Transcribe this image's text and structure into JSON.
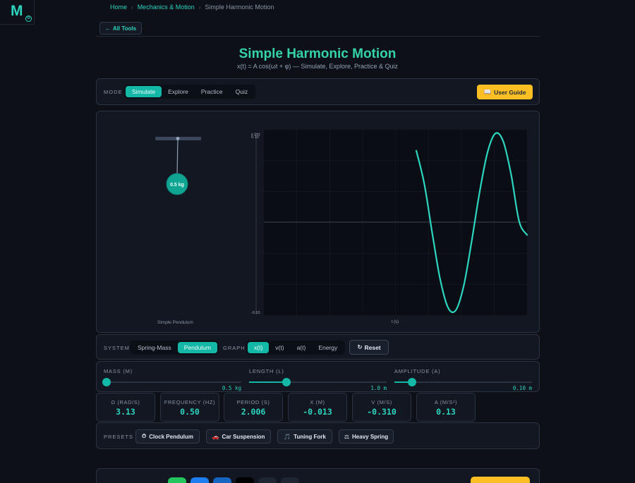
{
  "app": {
    "logo_letter": "M"
  },
  "breadcrumb": {
    "home": "Home",
    "section": "Mechanics & Motion",
    "current": "Simple Harmonic Motion",
    "sep": "›"
  },
  "nav": {
    "back_label": "All Tools",
    "back_icon": "←"
  },
  "header": {
    "title": "Simple Harmonic Motion",
    "formula": "x(t) = A cos(ωt + φ) — Simulate, Explore, Practice & Quiz"
  },
  "mode": {
    "label": "MODE",
    "tabs": [
      "Simulate",
      "Explore",
      "Practice",
      "Quiz"
    ],
    "active": 0,
    "guide_icon": "📖",
    "guide_label": "User Guide"
  },
  "simulation": {
    "bob_label": "0.5 kg",
    "caption": "Simple Pendulum",
    "graph": {
      "y_label": "x (m)",
      "y_max_label": "0.10",
      "y_min_label": "-0.10",
      "x_label": "t (s)",
      "curve_color": "#2dd4bf"
    }
  },
  "chart_data": {
    "type": "line",
    "xlabel": "t (s)",
    "ylabel": "x (m)",
    "ylim": [
      -0.1,
      0.1
    ],
    "x": [
      0.0,
      0.25,
      0.5,
      0.75,
      1.0,
      1.25,
      1.5,
      1.75,
      2.0,
      2.25,
      2.5,
      2.75,
      3.0,
      3.25,
      3.5
    ],
    "values": [
      0.08,
      0.044,
      -0.01,
      -0.061,
      -0.093,
      -0.096,
      -0.069,
      -0.02,
      0.034,
      0.078,
      0.099,
      0.09,
      0.053,
      0.002,
      -0.013
    ]
  },
  "controls": {
    "system_label": "SYSTEM",
    "system_options": [
      "Spring-Mass",
      "Pendulum"
    ],
    "system_active": 1,
    "graph_label": "GRAPH",
    "graph_options": [
      "x(t)",
      "v(t)",
      "a(t)",
      "Energy"
    ],
    "graph_active": 0,
    "reset_icon": "↻",
    "reset_label": "Reset"
  },
  "sliders": [
    {
      "name": "MASS (M)",
      "value": "0.5 kg",
      "fraction": 0.02
    },
    {
      "name": "LENGTH (L)",
      "value": "1.0 m",
      "fraction": 0.27
    },
    {
      "name": "AMPLITUDE (A)",
      "value": "0.10 m",
      "fraction": 0.13
    }
  ],
  "stats": [
    {
      "label": "Ω (RAD/S)",
      "value": "3.13"
    },
    {
      "label": "FREQUENCY (HZ)",
      "value": "0.50"
    },
    {
      "label": "PERIOD (S)",
      "value": "2.006"
    },
    {
      "label": "X (M)",
      "value": "-0.013"
    },
    {
      "label": "V (M/S)",
      "value": "-0.310"
    },
    {
      "label": "A (M/S²)",
      "value": "0.13"
    }
  ],
  "presets": {
    "label": "PRESETS",
    "items": [
      {
        "icon": "⏱",
        "label": "Clock Pendulum"
      },
      {
        "icon": "🚗",
        "label": "Car Suspension"
      },
      {
        "icon": "🎵",
        "label": "Tuning Fork"
      },
      {
        "icon": "⚖",
        "label": "Heavy Spring"
      }
    ]
  },
  "share": {
    "x_label": "𝕏"
  },
  "colors": {
    "accent": "#14b8a6",
    "accent_text": "#2dd4bf",
    "guide": "#fbbf24",
    "background": "#0d1017"
  }
}
